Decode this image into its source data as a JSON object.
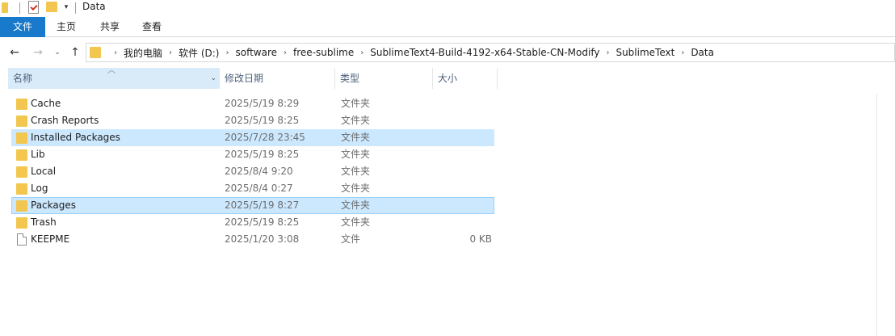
{
  "window": {
    "title": "Data"
  },
  "ribbon": {
    "tabs": {
      "file": "文件",
      "home": "主页",
      "share": "共享",
      "view": "查看"
    }
  },
  "address": {
    "breadcrumbs": [
      "我的电脑",
      "软件 (D:)",
      "software",
      "free-sublime",
      "SublimeText4-Build-4192-x64-Stable-CN-Modify",
      "SublimeText",
      "Data"
    ]
  },
  "columns": {
    "name": "名称",
    "date": "修改日期",
    "type": "类型",
    "size": "大小"
  },
  "files": [
    {
      "name": "Cache",
      "date": "2025/5/19 8:29",
      "type": "文件夹",
      "size": "",
      "kind": "folder",
      "state": ""
    },
    {
      "name": "Crash Reports",
      "date": "2025/5/19 8:25",
      "type": "文件夹",
      "size": "",
      "kind": "folder",
      "state": ""
    },
    {
      "name": "Installed Packages",
      "date": "2025/7/28 23:45",
      "type": "文件夹",
      "size": "",
      "kind": "folder",
      "state": "selected"
    },
    {
      "name": "Lib",
      "date": "2025/5/19 8:25",
      "type": "文件夹",
      "size": "",
      "kind": "folder",
      "state": ""
    },
    {
      "name": "Local",
      "date": "2025/8/4 9:20",
      "type": "文件夹",
      "size": "",
      "kind": "folder",
      "state": ""
    },
    {
      "name": "Log",
      "date": "2025/8/4 0:27",
      "type": "文件夹",
      "size": "",
      "kind": "folder",
      "state": ""
    },
    {
      "name": "Packages",
      "date": "2025/5/19 8:27",
      "type": "文件夹",
      "size": "",
      "kind": "folder",
      "state": "focused"
    },
    {
      "name": "Trash",
      "date": "2025/5/19 8:25",
      "type": "文件夹",
      "size": "",
      "kind": "folder",
      "state": ""
    },
    {
      "name": "KEEPME",
      "date": "2025/1/20 3:08",
      "type": "文件",
      "size": "0 KB",
      "kind": "file",
      "state": ""
    }
  ],
  "colors": {
    "accent": "#1979ca",
    "selection": "#cce8ff",
    "focus_border": "#99d1ff",
    "folder": "#f3c64f"
  }
}
